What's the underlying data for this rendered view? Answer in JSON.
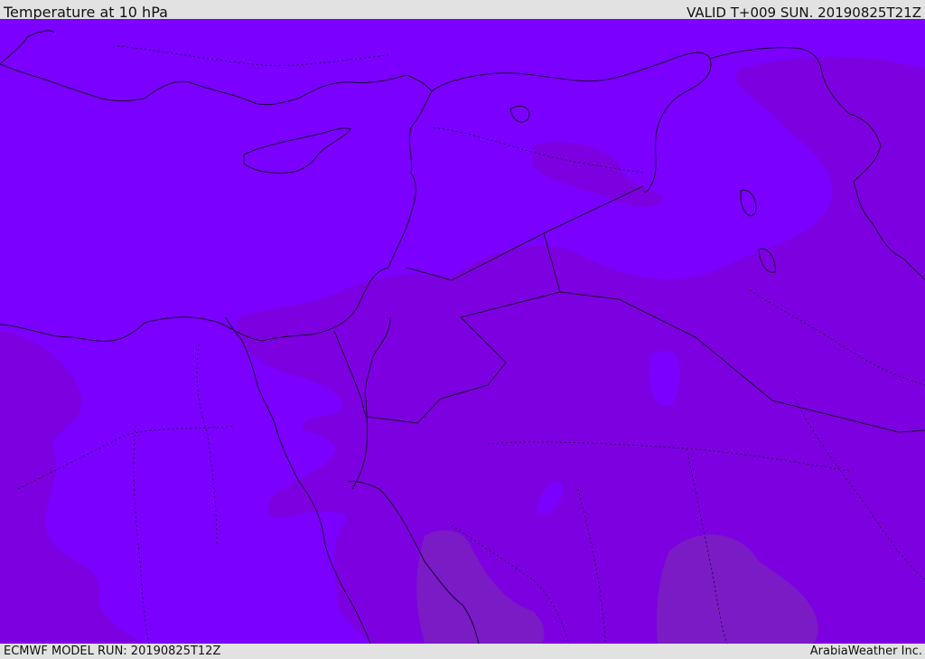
{
  "header": {
    "title": "Temperature at 10 hPa",
    "valid": "VALID T+009 SUN. 20190825T21Z"
  },
  "footer": {
    "model_run": "ECMWF MODEL RUN: 20190825T12Z",
    "credit": "ArabiaWeather Inc."
  },
  "colors": {
    "field_primary": "#7b00ff",
    "field_secondary": "#7d00e0",
    "field_tertiary": "#7a1bc6",
    "boundary_line": "#1a0033"
  }
}
